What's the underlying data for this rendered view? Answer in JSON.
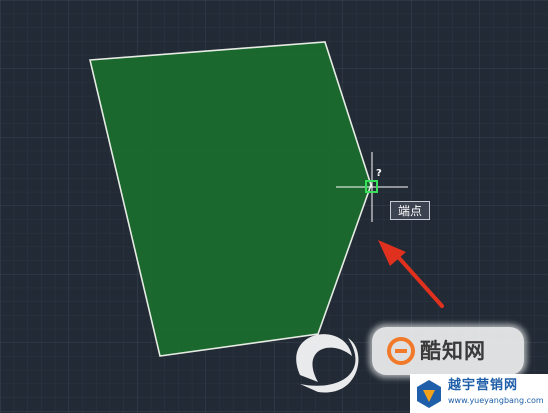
{
  "cursor": {
    "tooltip_label": "端点",
    "snap_hint": "?"
  },
  "watermark": {
    "badge_text": "酷知网",
    "site_name": "越宇营销网",
    "site_url": "www.yueyangbang.com"
  },
  "colors": {
    "background": "#222a35",
    "grid": "#323b48",
    "shape_fill": "#1b6b2e",
    "shape_outline": "#e6ece4",
    "arrow": "#e0301e",
    "snap_marker": "#39e05a"
  }
}
